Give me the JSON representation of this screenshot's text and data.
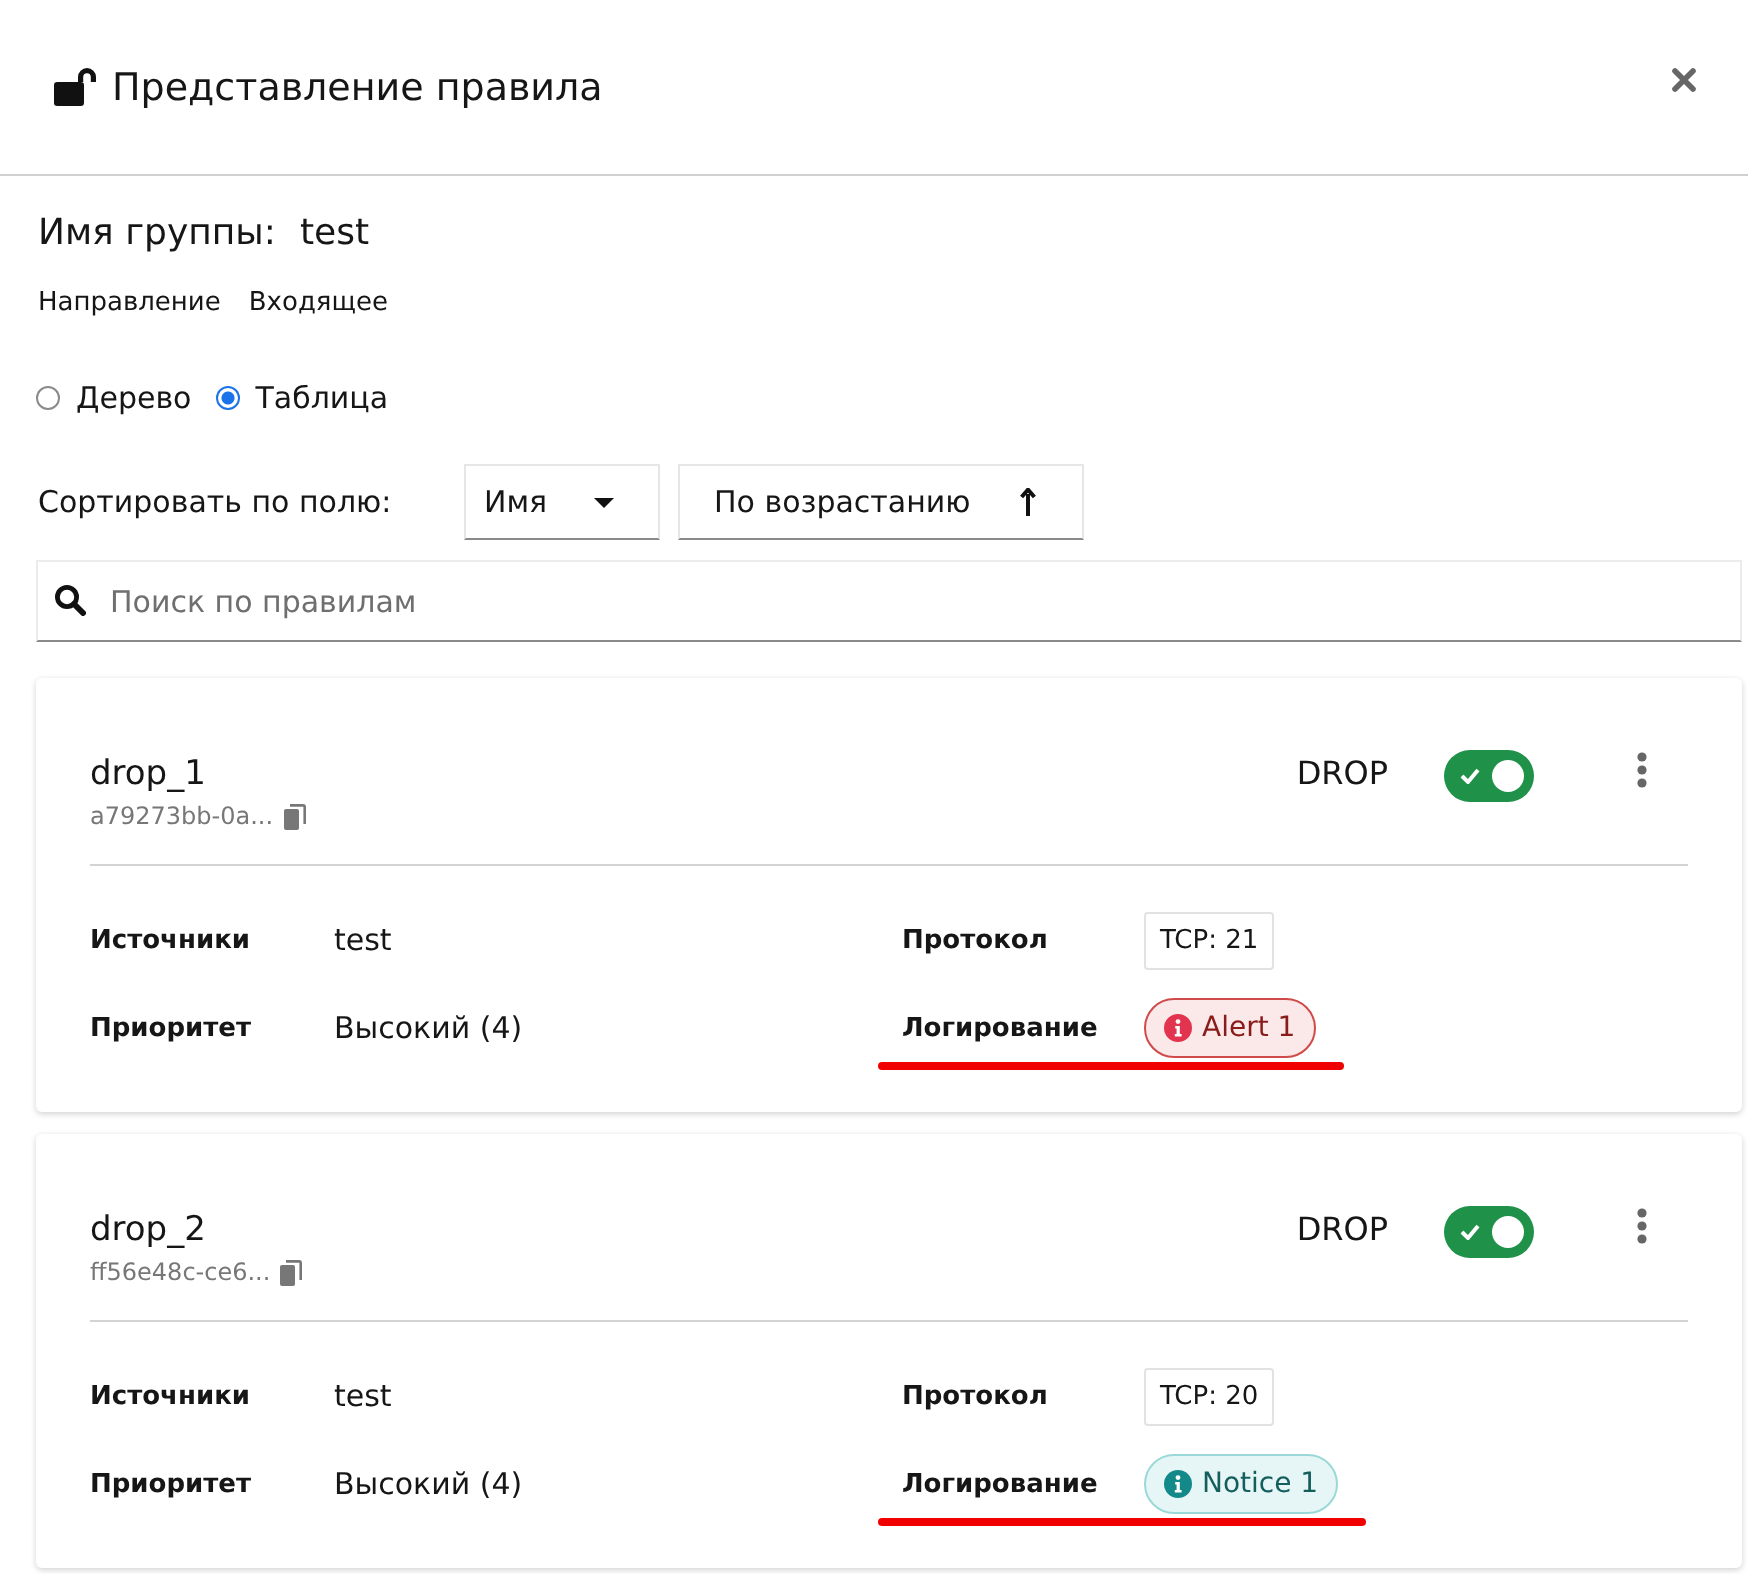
{
  "dialog": {
    "title": "Представление правила"
  },
  "group": {
    "label": "Имя группы:",
    "value": "test"
  },
  "direction": {
    "label": "Направление",
    "value": "Входящее"
  },
  "view_modes": [
    {
      "label": "Дерево",
      "selected": false
    },
    {
      "label": "Таблица",
      "selected": true
    }
  ],
  "sort": {
    "label": "Сортировать по полю:",
    "field": "Имя",
    "order": "По возрастанию"
  },
  "search": {
    "placeholder": "Поиск по правилам"
  },
  "rules": [
    {
      "name": "drop_1",
      "id": "a79273bb-0a...",
      "action": "DROP",
      "enabled": true,
      "sources": {
        "label": "Источники",
        "value": "test"
      },
      "protocol": {
        "label": "Протокол",
        "value": "TCP: 21"
      },
      "priority": {
        "label": "Приоритет",
        "value": "Высокий (4)"
      },
      "logging": {
        "label": "Логирование",
        "value": "Alert 1",
        "kind": "alert",
        "underlined": true
      }
    },
    {
      "name": "drop_2",
      "id": "ff56e48c-ce6...",
      "action": "DROP",
      "enabled": true,
      "sources": {
        "label": "Источники",
        "value": "test"
      },
      "protocol": {
        "label": "Протокол",
        "value": "TCP: 20"
      },
      "priority": {
        "label": "Приоритет",
        "value": "Высокий (4)"
      },
      "logging": {
        "label": "Логирование",
        "value": "Notice 1",
        "kind": "notice",
        "underlined": true
      }
    }
  ]
}
